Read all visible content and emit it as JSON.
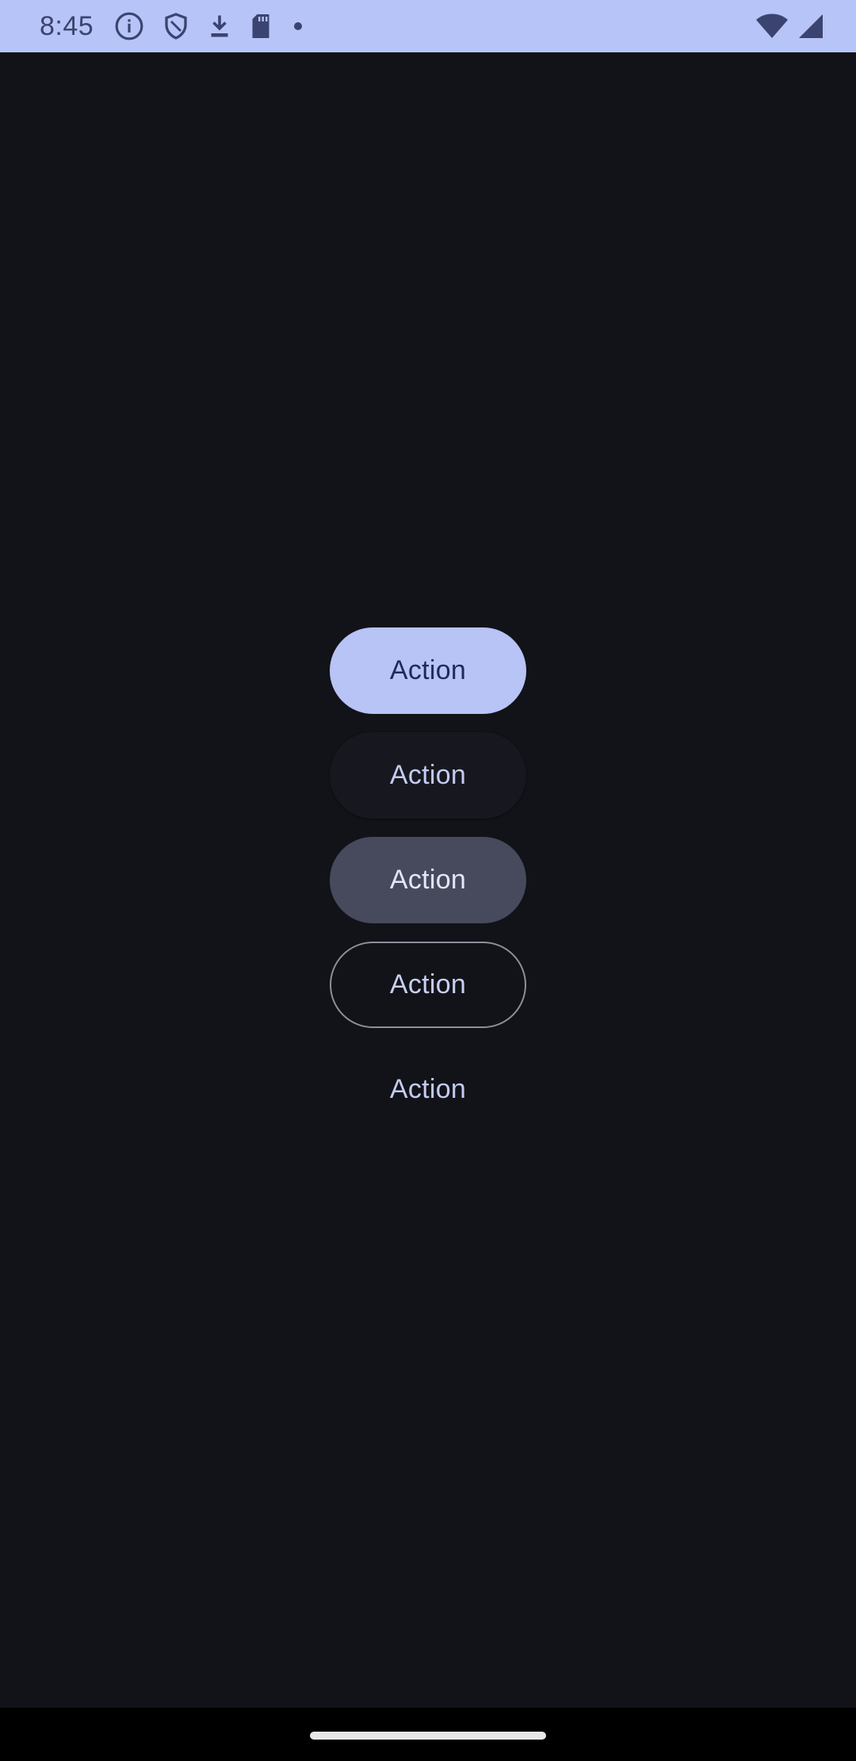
{
  "status_bar": {
    "time": "8:45",
    "background": "#b7c4f7",
    "icons_left": [
      "info-icon",
      "shield-icon",
      "download-icon",
      "sd-card-icon",
      "notification-dot-icon"
    ],
    "icons_right": [
      "wifi-icon",
      "cell-signal-icon"
    ]
  },
  "buttons": [
    {
      "variant": "filled",
      "label": "Action"
    },
    {
      "variant": "elevated",
      "label": "Action"
    },
    {
      "variant": "tonal",
      "label": "Action"
    },
    {
      "variant": "outlined",
      "label": "Action"
    },
    {
      "variant": "text",
      "label": "Action"
    }
  ],
  "colors": {
    "background": "#121318",
    "primary_container": "#b8c3f6",
    "tonal": "#464a5c",
    "outline": "#8d8f9c"
  }
}
